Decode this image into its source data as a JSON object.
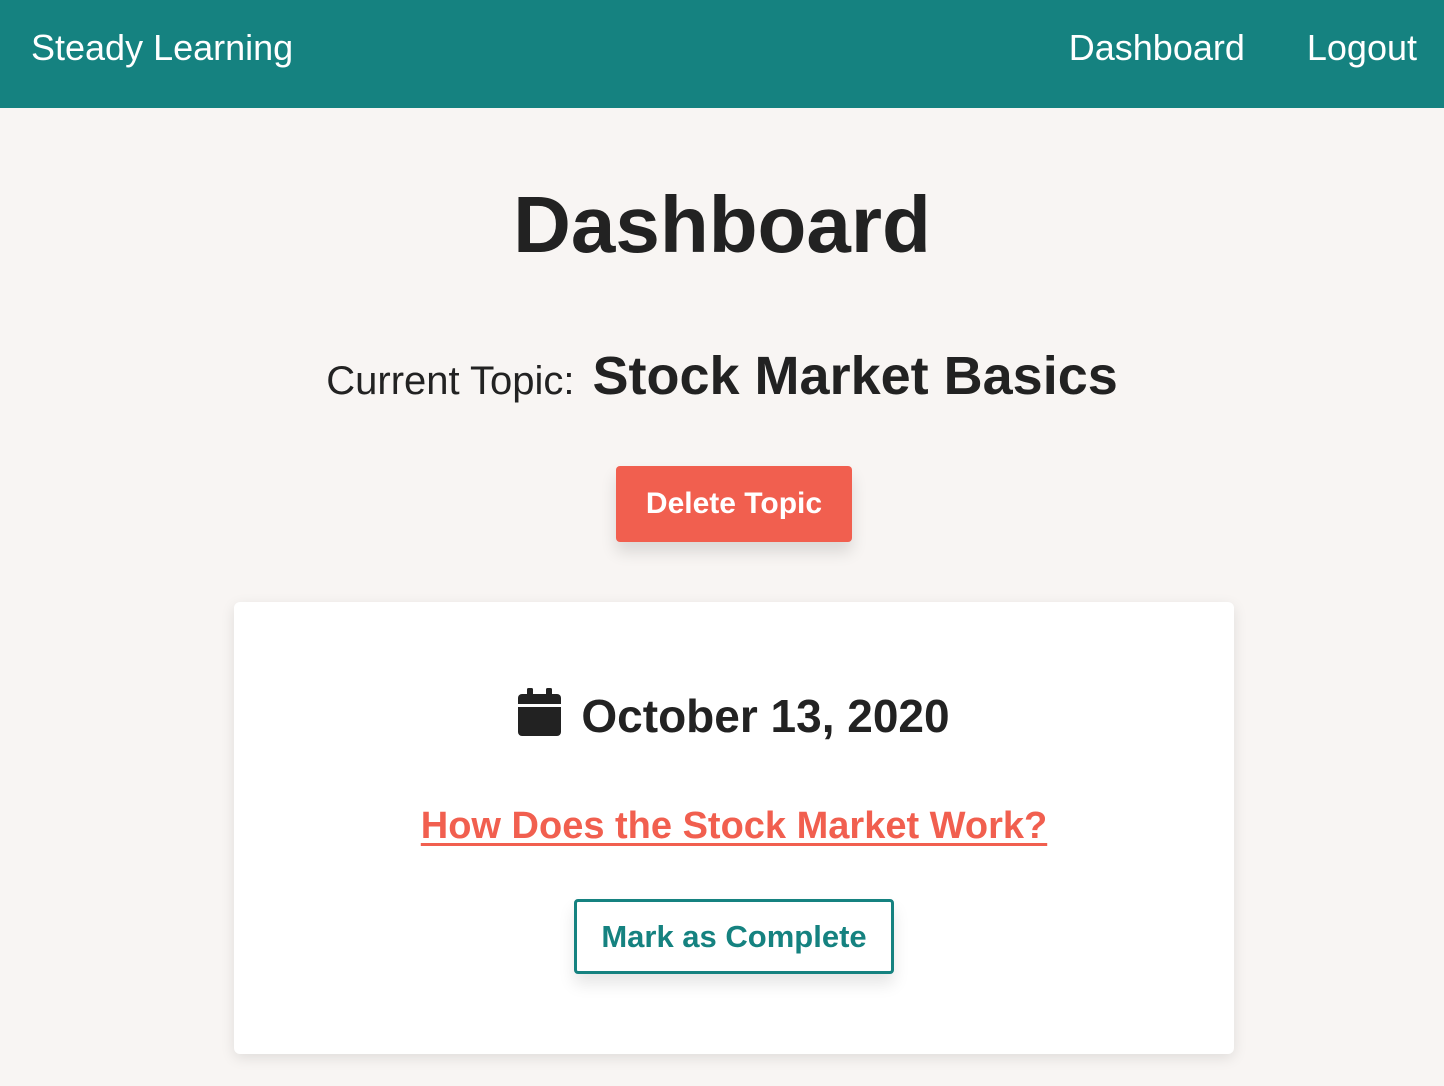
{
  "nav": {
    "brand": "Steady Learning",
    "links": [
      {
        "label": "Dashboard"
      },
      {
        "label": "Logout"
      }
    ]
  },
  "main": {
    "title": "Dashboard",
    "current_topic_label": "Current Topic:",
    "current_topic_name": "Stock Market Basics",
    "delete_button_label": "Delete Topic"
  },
  "lesson_card": {
    "icon": "calendar-icon",
    "date": "October 13, 2020",
    "link_text": "How Does the Stock Market Work?",
    "complete_button_label": "Mark as Complete"
  },
  "colors": {
    "navbar": "#158280",
    "accent": "#f15f4f",
    "teal": "#158280",
    "background": "#f8f5f3"
  }
}
